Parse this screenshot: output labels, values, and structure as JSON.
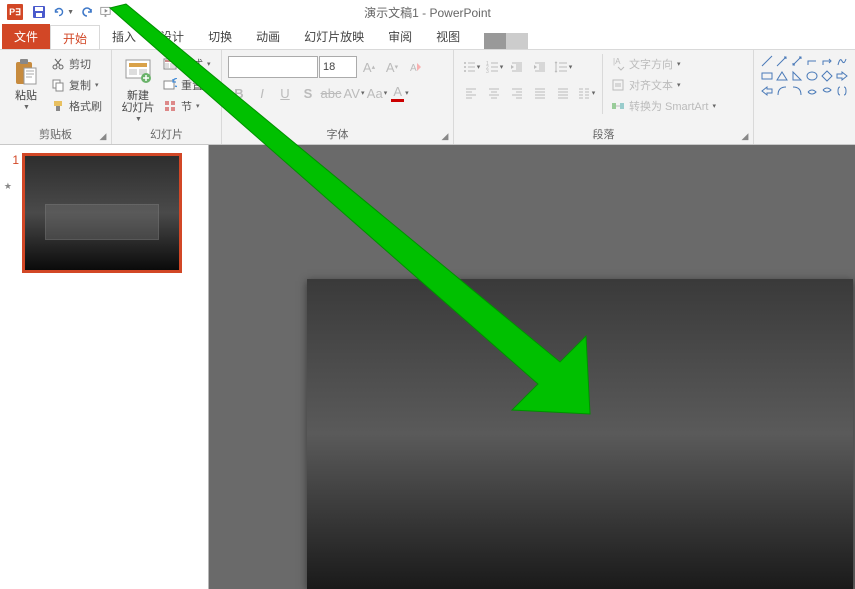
{
  "app": {
    "title": "演示文稿1 - PowerPoint"
  },
  "tabs": {
    "file": "文件",
    "home": "开始",
    "insert": "插入",
    "design": "设计",
    "transitions": "切换",
    "animations": "动画",
    "slideshow": "幻灯片放映",
    "review": "审阅",
    "view": "视图"
  },
  "ribbon": {
    "clipboard": {
      "label": "剪贴板",
      "paste": "粘贴",
      "cut": "剪切",
      "copy": "复制",
      "format_painter": "格式刷"
    },
    "slides": {
      "label": "幻灯片",
      "new_slide": "新建\n幻灯片",
      "layout": "版式",
      "reset": "重置",
      "section": "节"
    },
    "font": {
      "label": "字体",
      "size": "18"
    },
    "paragraph": {
      "label": "段落",
      "text_direction": "文字方向",
      "align_text": "对齐文本",
      "convert_smartart": "转换为 SmartArt"
    }
  },
  "thumb": {
    "index": "1"
  },
  "chart_data": null
}
